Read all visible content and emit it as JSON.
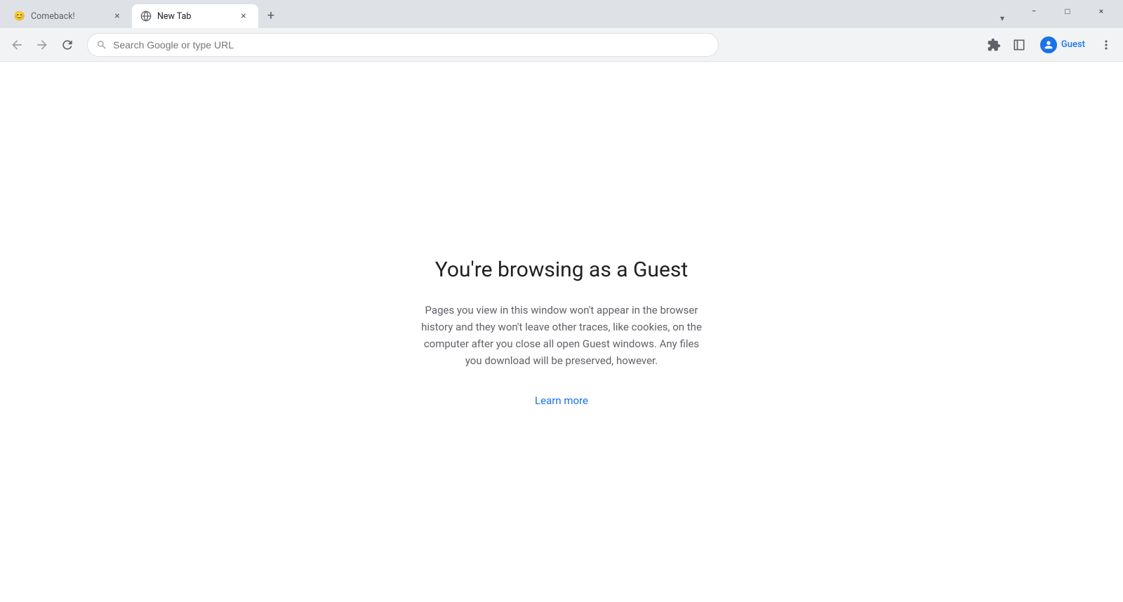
{
  "browser": {
    "tabs": [
      {
        "id": "tab-comeback",
        "title": "Comeback!",
        "favicon": "😊",
        "active": false
      },
      {
        "id": "tab-new",
        "title": "New Tab",
        "favicon": "🌐",
        "active": true
      }
    ],
    "new_tab_label": "+",
    "tab_list_icon": "▾"
  },
  "window_controls": {
    "minimize": "−",
    "maximize": "□",
    "close": "×"
  },
  "toolbar": {
    "back_icon": "←",
    "forward_icon": "→",
    "reload_icon": "↻",
    "address_placeholder": "Search Google or type URL",
    "extensions_icon": "🧩",
    "profile_label": "Guest",
    "profile_icon": "👤",
    "menu_icon": "⋮"
  },
  "main": {
    "heading": "You're browsing as a Guest",
    "description": "Pages you view in this window won't appear in the browser history and they won't leave other traces, like cookies, on the computer after you close all open Guest windows. Any files you download will be preserved, however.",
    "learn_more_text": "Learn more"
  }
}
